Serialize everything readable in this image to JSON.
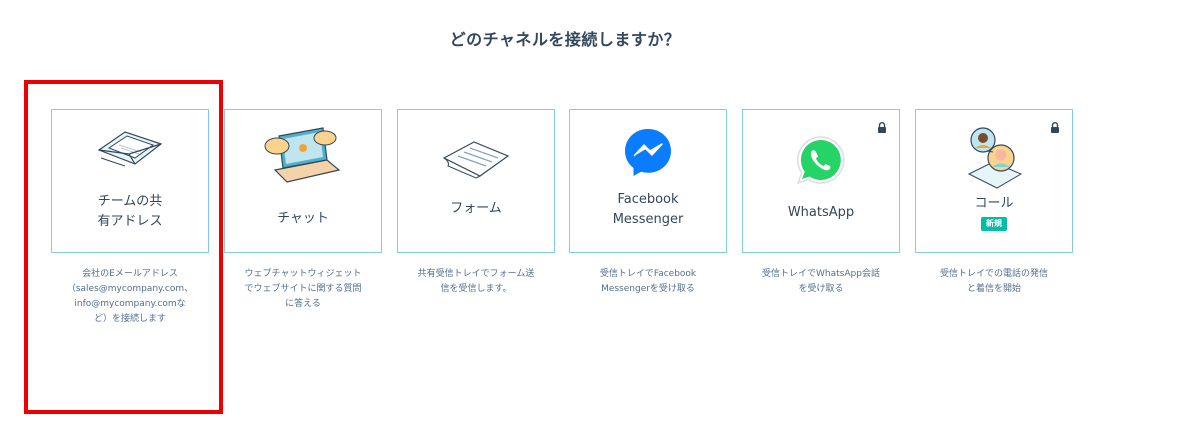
{
  "heading": "どのチャネルを接続しますか？",
  "channels": [
    {
      "label": "チームの共\n有アドレス",
      "description": "会社のEメールアドレス\n（sales@mycompany.com、\ninfo@mycompany.comな\nど）を接続します",
      "icon": "envelope-icon",
      "locked": false
    },
    {
      "label": "チャット",
      "description": "ウェブチャットウィジェット\nでウェブサイトに関する質問\nに答える",
      "icon": "laptop-chat-icon",
      "locked": false
    },
    {
      "label": "フォーム",
      "description": "共有受信トレイでフォーム送\n信を受信します。",
      "icon": "form-paper-icon",
      "locked": false
    },
    {
      "label": "Facebook\nMessenger",
      "description": "受信トレイでFacebook\nMessengerを受け取る",
      "icon": "messenger-icon",
      "locked": false
    },
    {
      "label": "WhatsApp",
      "description": "受信トレイでWhatsApp会話\nを受け取る",
      "icon": "whatsapp-icon",
      "locked": true
    },
    {
      "label": "コール",
      "description": "受信トレイでの電話の発信\nと着信を開始",
      "icon": "calling-icon",
      "locked": true,
      "badge": "新規"
    }
  ],
  "colors": {
    "card_border": "#7fd1de",
    "highlight": "#ee0000",
    "badge": "#00bda5",
    "messenger": "#0a7cff",
    "whatsapp": "#25d366"
  }
}
